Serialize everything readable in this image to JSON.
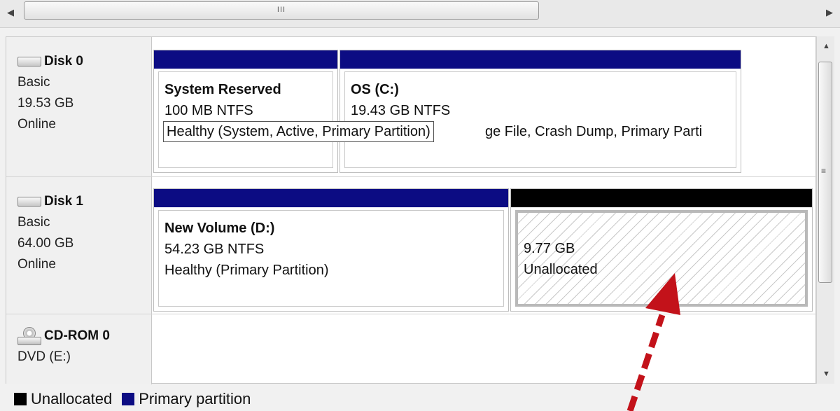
{
  "colors": {
    "primary": "#0c0c83",
    "unallocated": "#000000",
    "arrow": "#c3121a"
  },
  "scrollbar": {
    "grip": "III",
    "vgrip": "≡"
  },
  "tooltip": "Healthy (System, Active, Primary Partition)",
  "disks": [
    {
      "name": "Disk 0",
      "type": "Basic",
      "size": "19.53 GB",
      "status": "Online",
      "partitions": [
        {
          "title": "System Reserved",
          "size": "100 MB NTFS",
          "status": ""
        },
        {
          "title": "OS  (C:)",
          "size": "19.43 GB NTFS",
          "status": "ge File, Crash Dump, Primary Parti"
        }
      ]
    },
    {
      "name": "Disk 1",
      "type": "Basic",
      "size": "64.00 GB",
      "status": "Online",
      "partitions": [
        {
          "title": "New Volume  (D:)",
          "size": "54.23 GB NTFS",
          "status": "Healthy (Primary Partition)"
        },
        {
          "title": "",
          "size": "9.77 GB",
          "status": "Unallocated"
        }
      ]
    },
    {
      "name": "CD-ROM 0",
      "type": "DVD (E:)"
    }
  ],
  "legend": [
    {
      "label": "Unallocated",
      "icon": "black-square"
    },
    {
      "label": "Primary partition",
      "icon": "blue-square"
    }
  ]
}
